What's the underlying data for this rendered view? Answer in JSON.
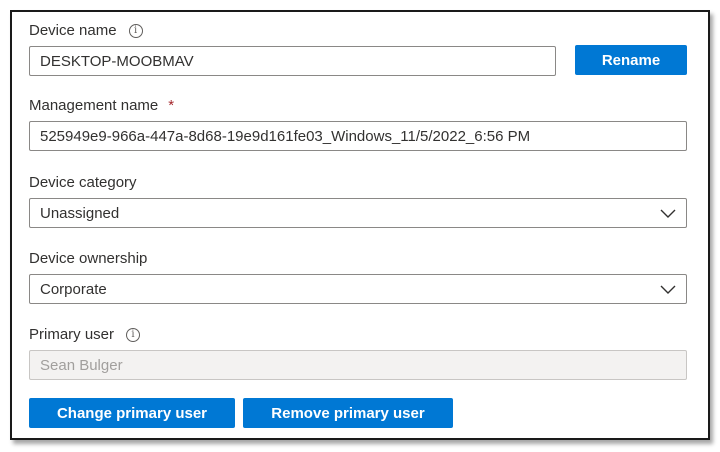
{
  "device_name": {
    "label": "Device name",
    "value": "DESKTOP-MOOBMAV",
    "rename_label": "Rename",
    "info_glyph": "i"
  },
  "management_name": {
    "label": "Management name",
    "required_mark": "*",
    "value": "525949e9-966a-447a-8d68-19e9d161fe03_Windows_11/5/2022_6:56 PM"
  },
  "device_category": {
    "label": "Device category",
    "value": "Unassigned"
  },
  "device_ownership": {
    "label": "Device ownership",
    "value": "Corporate"
  },
  "primary_user": {
    "label": "Primary user",
    "value": "Sean Bulger",
    "info_glyph": "i"
  },
  "actions": {
    "change_primary_user": "Change primary user",
    "remove_primary_user": "Remove primary user"
  },
  "colors": {
    "accent": "#0078d4",
    "required": "#a4262c",
    "disabled_bg": "#f3f2f1"
  },
  "icons": {
    "info": "info-icon",
    "dropdown": "chevron-down-icon"
  }
}
